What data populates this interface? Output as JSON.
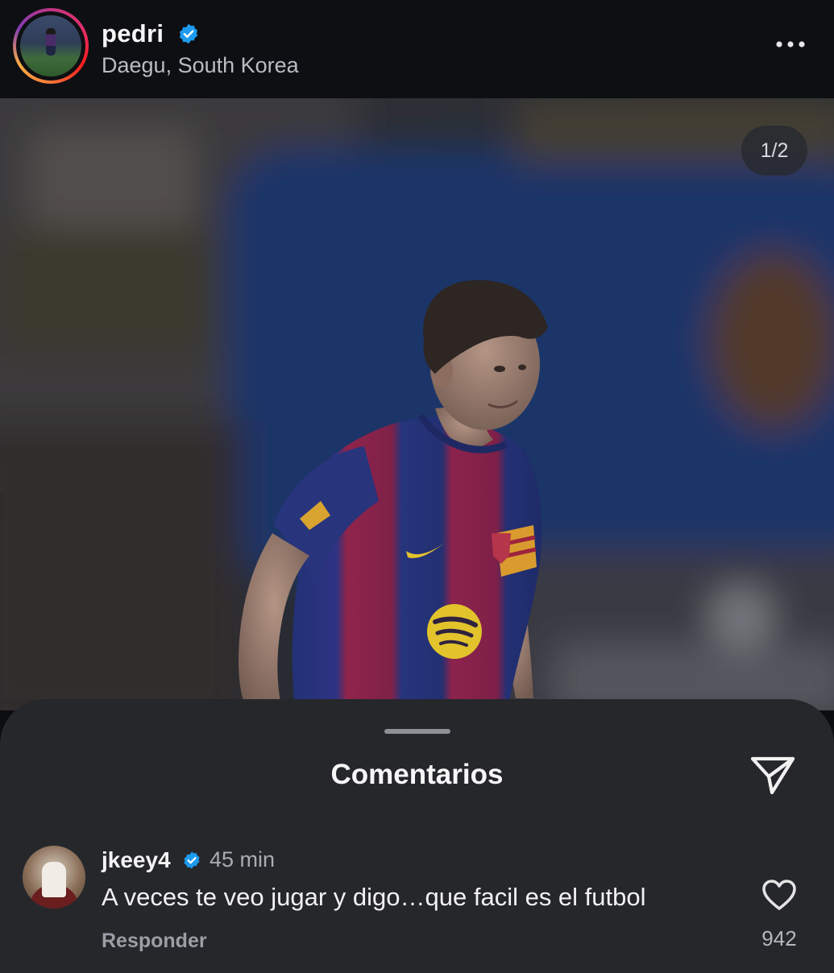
{
  "post": {
    "username": "pedri",
    "location": "Daegu, South Korea",
    "verified": true,
    "verified_color": "#1d9bf0",
    "more_icon": "more-horizontal-icon",
    "slide_counter": "1/2",
    "photo_alt_colors": {
      "kit_blue": "#1d2f78",
      "kit_red": "#8e1f4a",
      "sponsor_yellow": "#e2c228"
    }
  },
  "comments_sheet": {
    "title": "Comentarios",
    "share_icon": "send-icon",
    "comments": [
      {
        "username": "jkeey4",
        "verified": true,
        "time": "45 min",
        "text": "A veces te veo jugar y digo…que facil es el futbol",
        "reply_label": "Responder",
        "like_icon": "heart-outline-icon",
        "likes": "942"
      }
    ]
  }
}
